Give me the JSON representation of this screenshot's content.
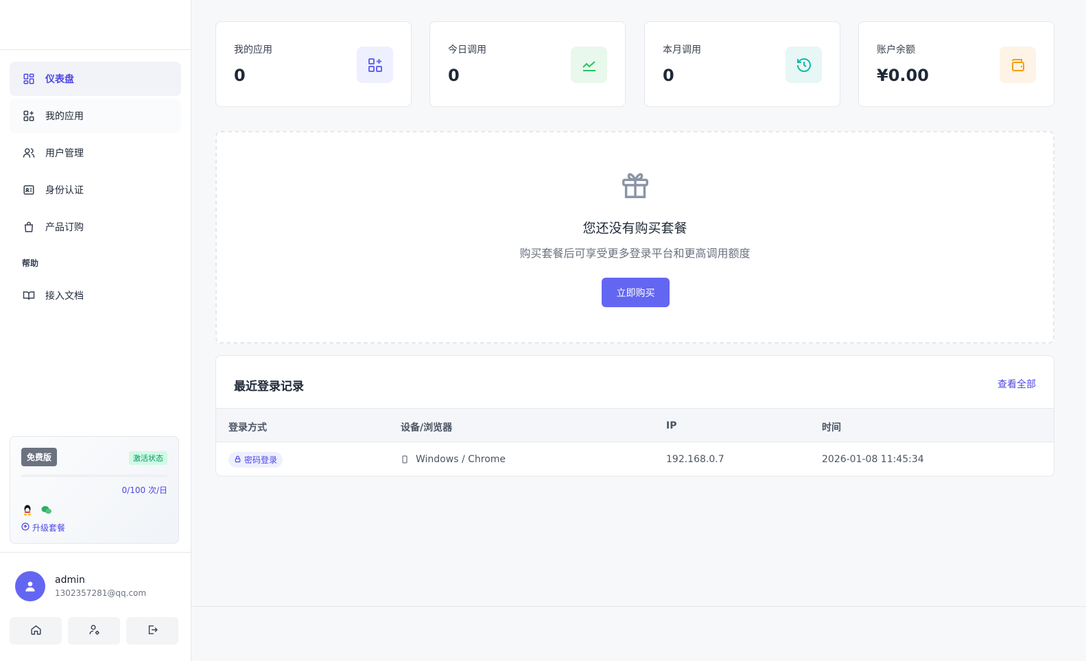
{
  "sidebar": {
    "nav": [
      {
        "label": "仪表盘",
        "icon": "dashboard-icon",
        "active": true
      },
      {
        "label": "我的应用",
        "icon": "apps-icon"
      },
      {
        "label": "用户管理",
        "icon": "users-icon"
      },
      {
        "label": "身份认证",
        "icon": "id-card-icon"
      },
      {
        "label": "产品订购",
        "icon": "shopping-bag-icon"
      }
    ],
    "help_section": "帮助",
    "help_items": [
      {
        "label": "接入文档",
        "icon": "book-icon"
      }
    ],
    "plan": {
      "name": "免费版",
      "status": "激活状态",
      "usage": "0/100 次/日",
      "upgrade": "升级套餐"
    },
    "user": {
      "name": "admin",
      "email": "1302357281@qq.com"
    }
  },
  "stats": [
    {
      "label": "我的应用",
      "value": "0",
      "icon": "apps-add-icon",
      "color": "#6366f1",
      "bg": "#eef0ff"
    },
    {
      "label": "今日调用",
      "value": "0",
      "icon": "trend-icon",
      "color": "#22c55e",
      "bg": "#e8f8ec"
    },
    {
      "label": "本月调用",
      "value": "0",
      "icon": "history-icon",
      "color": "#14b8a6",
      "bg": "#e6f7f5"
    },
    {
      "label": "账户余额",
      "value": "¥0.00",
      "icon": "wallet-icon",
      "color": "#f59e0b",
      "bg": "#fdf3e6"
    }
  ],
  "promo": {
    "title": "您还没有购买套餐",
    "subtitle": "购买套餐后可享受更多登录平台和更高调用额度",
    "button": "立即购买"
  },
  "logins": {
    "title": "最近登录记录",
    "view_all": "查看全部",
    "columns": [
      "登录方式",
      "设备/浏览器",
      "IP",
      "时间"
    ],
    "rows": [
      {
        "method": "密码登录",
        "device": "Windows / Chrome",
        "ip": "192.168.0.7",
        "time": "2026-01-08 11:45:34"
      }
    ]
  },
  "colors": {
    "accent": "#6366f1"
  }
}
